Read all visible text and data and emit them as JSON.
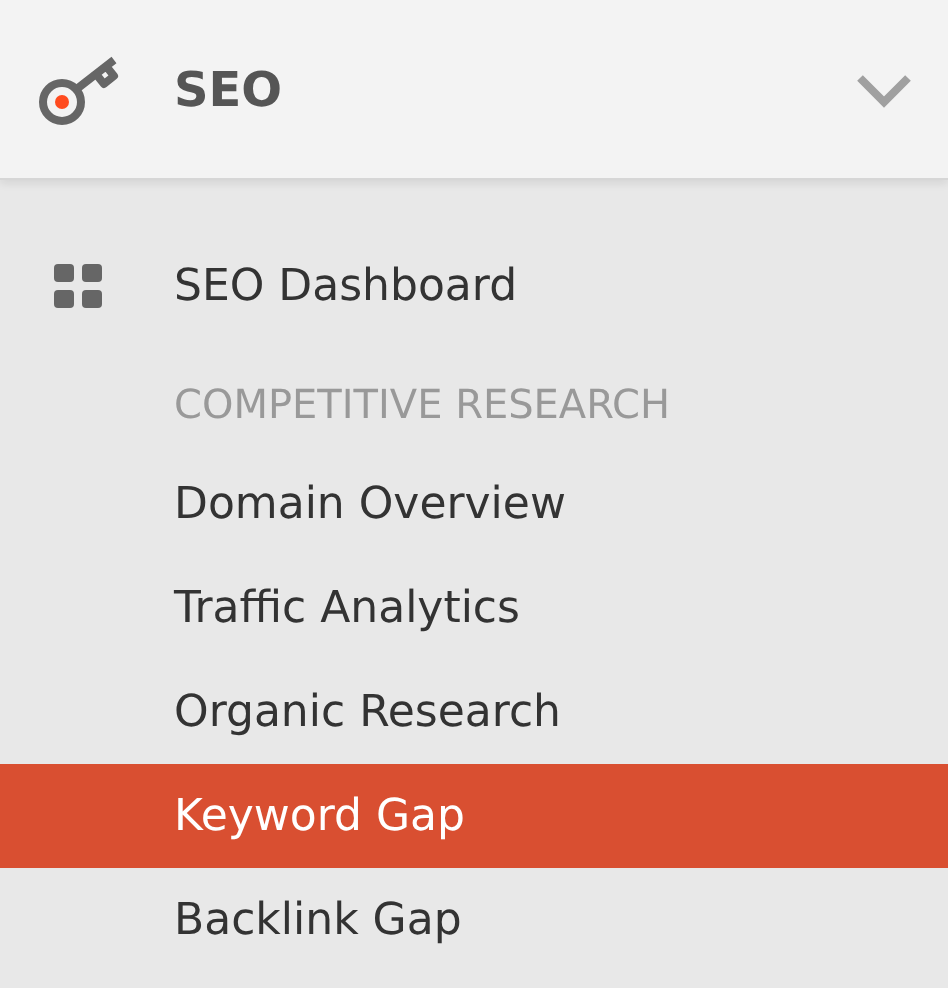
{
  "section": {
    "title": "SEO",
    "expanded": true
  },
  "items": [
    {
      "kind": "dashboard",
      "label": "SEO Dashboard",
      "selected": false
    },
    {
      "kind": "heading",
      "label": "COMPETITIVE RESEARCH"
    },
    {
      "kind": "link",
      "label": "Domain Overview",
      "selected": false
    },
    {
      "kind": "link",
      "label": "Traffic Analytics",
      "selected": false
    },
    {
      "kind": "link",
      "label": "Organic Research",
      "selected": false
    },
    {
      "kind": "link",
      "label": "Keyword Gap",
      "selected": true
    },
    {
      "kind": "link",
      "label": "Backlink Gap",
      "selected": false
    }
  ]
}
